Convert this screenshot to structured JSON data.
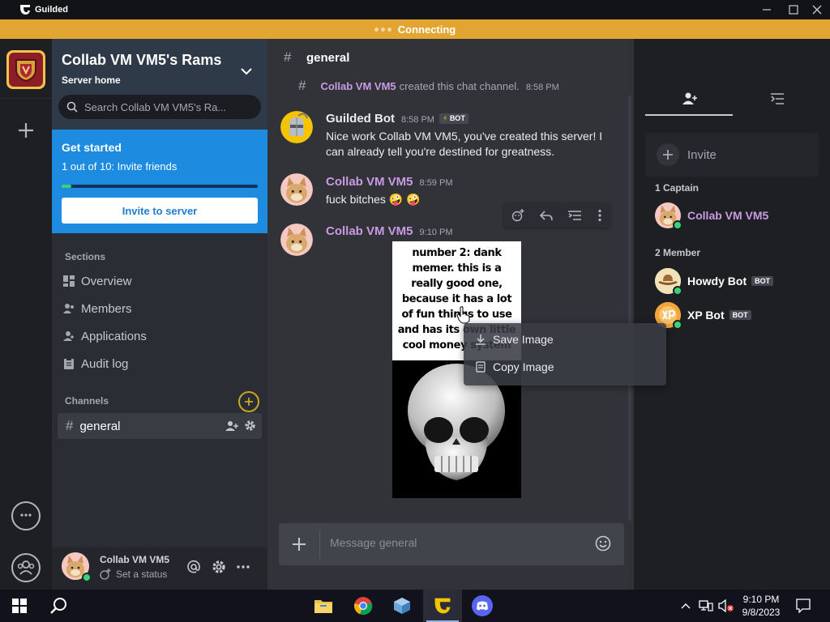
{
  "window": {
    "app_name": "Guilded"
  },
  "banner": {
    "text": "Connecting"
  },
  "server": {
    "name": "Collab VM VM5's Rams",
    "subtitle": "Server home",
    "search_placeholder": "Search Collab VM VM5's Ra..."
  },
  "get_started": {
    "title": "Get started",
    "progress_text": "1 out of 10: Invite friends",
    "progress_fraction": 0.05,
    "button_label": "Invite to server"
  },
  "sections": {
    "label": "Sections",
    "items": [
      "Overview",
      "Members",
      "Applications",
      "Audit log"
    ]
  },
  "channels": {
    "label": "Channels",
    "items": [
      {
        "name": "general"
      }
    ]
  },
  "user": {
    "name": "Collab VM VM5",
    "status": "Set a status"
  },
  "chat": {
    "channel_name": "general",
    "system_message": {
      "user": "Collab VM VM5",
      "text": "created this chat channel.",
      "time": "8:58 PM"
    },
    "messages": [
      {
        "author": "Guilded Bot",
        "time": "8:58 PM",
        "badge": "BOT",
        "text": "Nice work Collab VM VM5, you've created this server! I can already tell you're destined for greatness."
      },
      {
        "author": "Collab VM VM5",
        "time": "8:59 PM",
        "text": "fuck bitches 🤪 🤪"
      },
      {
        "author": "Collab VM VM5",
        "time": "9:10 PM",
        "image_caption": "number 2: dank memer. this is a really good one, because it has a lot of fun things to use and has its own little cool money system"
      }
    ],
    "composer_placeholder": "Message general"
  },
  "context_menu": {
    "items": [
      "Save Image",
      "Copy Image"
    ]
  },
  "members_panel": {
    "invite_label": "Invite",
    "groups": [
      {
        "label": "1 Captain",
        "members": [
          {
            "name": "Collab VM VM5",
            "color": "#c99be3"
          }
        ]
      },
      {
        "label": "2 Member",
        "members": [
          {
            "name": "Howdy Bot",
            "badge": "BOT",
            "color": "#ffffff"
          },
          {
            "name": "XP Bot",
            "badge": "BOT",
            "color": "#ffffff"
          }
        ]
      }
    ]
  },
  "colors": {
    "accent_purple": "#c99be3",
    "banner": "#e3a532",
    "guilded_yellow": "#f5c400",
    "blue_card": "#1d8be0"
  },
  "taskbar": {
    "time": "9:10 PM",
    "date": "9/8/2023"
  }
}
